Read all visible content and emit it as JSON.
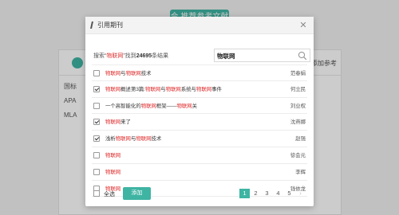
{
  "background": {
    "top_button_label": "合 推荐参考文献",
    "side_label": "添加参考",
    "citation_styles": [
      "国标",
      "APA",
      "MLA"
    ]
  },
  "modal": {
    "title": "引用期刊",
    "close_icon": "close-icon",
    "search": {
      "summary_prefix": "搜索“",
      "keyword": "物联网",
      "summary_middle": "”找到",
      "result_count": "24695",
      "summary_suffix": "条结果",
      "input_value": "物联网",
      "icon": "search-icon"
    },
    "results": [
      {
        "checked": false,
        "title_parts": [
          {
            "t": "物联网",
            "hl": true
          },
          {
            "t": "与",
            "hl": false
          },
          {
            "t": "物联网",
            "hl": true
          },
          {
            "t": "技术",
            "hl": false
          }
        ],
        "author": "范春娟"
      },
      {
        "checked": true,
        "title_parts": [
          {
            "t": "物联网",
            "hl": true
          },
          {
            "t": "概述第3篇:",
            "hl": false
          },
          {
            "t": "物联网",
            "hl": true
          },
          {
            "t": "与",
            "hl": false
          },
          {
            "t": "物联网",
            "hl": true
          },
          {
            "t": "系统与",
            "hl": false
          },
          {
            "t": "物联网",
            "hl": true
          },
          {
            "t": "事件",
            "hl": false
          }
        ],
        "author": "何立民"
      },
      {
        "checked": false,
        "title_parts": [
          {
            "t": "一个高智能化的",
            "hl": false
          },
          {
            "t": "物联网",
            "hl": true
          },
          {
            "t": "框架——",
            "hl": false
          },
          {
            "t": "物联网",
            "hl": true
          },
          {
            "t": "关",
            "hl": false
          }
        ],
        "author": "刘业权"
      },
      {
        "checked": true,
        "title_parts": [
          {
            "t": "物联网",
            "hl": true
          },
          {
            "t": "来了",
            "hl": false
          }
        ],
        "author": "沈燕娜"
      },
      {
        "checked": true,
        "title_parts": [
          {
            "t": "浅析",
            "hl": false
          },
          {
            "t": "物联网",
            "hl": true
          },
          {
            "t": "与",
            "hl": false
          },
          {
            "t": "物联网",
            "hl": true
          },
          {
            "t": "技术",
            "hl": false
          }
        ],
        "author": "赵强"
      },
      {
        "checked": false,
        "title_parts": [
          {
            "t": "物联网",
            "hl": true
          }
        ],
        "author": "徐会元"
      },
      {
        "checked": false,
        "title_parts": [
          {
            "t": "物联网",
            "hl": true
          }
        ],
        "author": "李辉"
      },
      {
        "checked": false,
        "title_parts": [
          {
            "t": "物联网",
            "hl": true
          }
        ],
        "author": "钱依龙"
      }
    ],
    "footer": {
      "select_all_label": "全选",
      "add_button_label": "添加",
      "pages": [
        "1",
        "2",
        "3",
        "4",
        "5"
      ],
      "current_page": "1",
      "next_icon": "chevron-right-icon"
    }
  },
  "colors": {
    "accent": "#3fb4a3",
    "highlight": "#e03030"
  }
}
